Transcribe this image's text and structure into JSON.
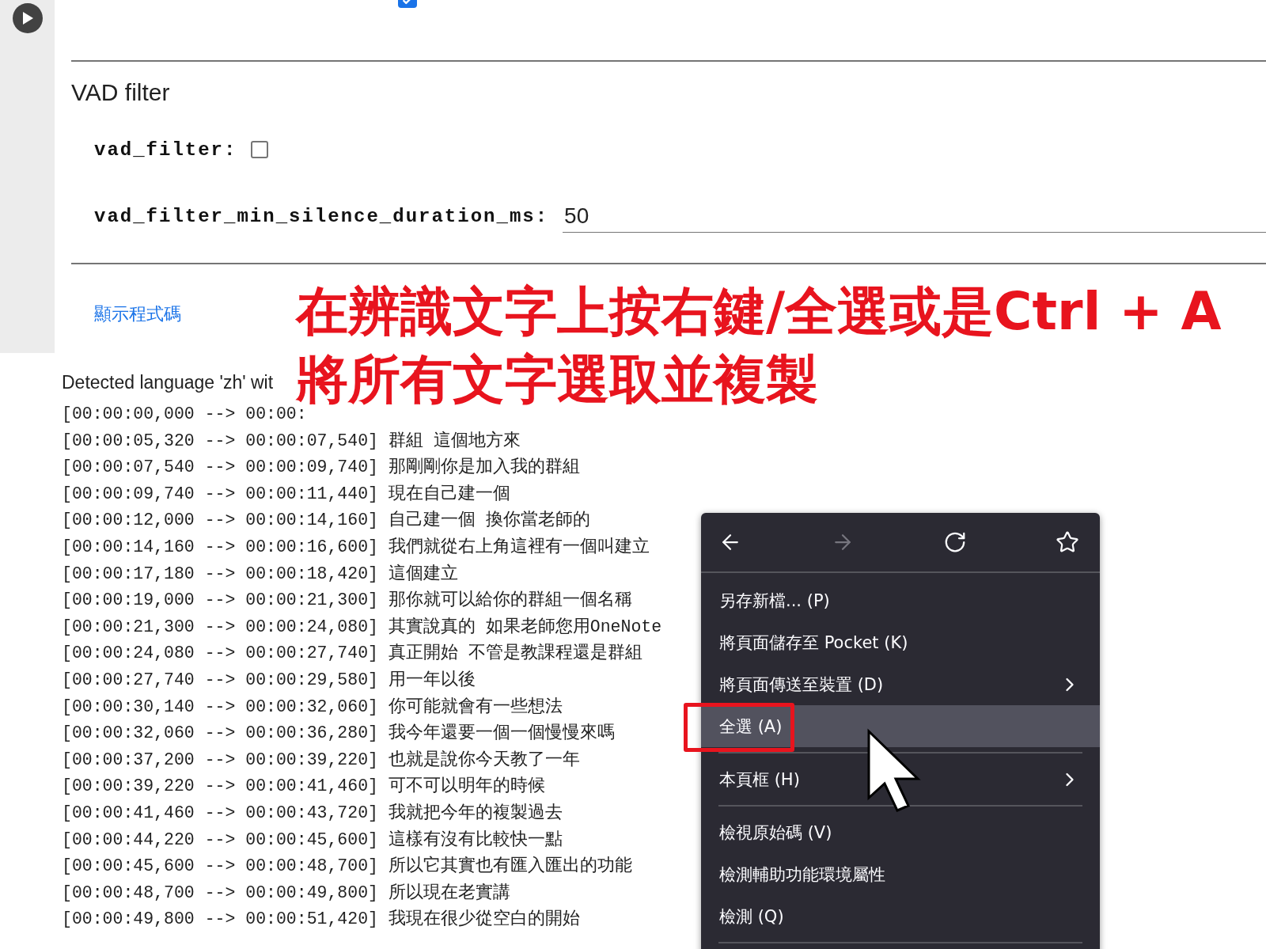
{
  "cell": {
    "top_checkbox": {
      "checked": true
    },
    "section": {
      "title": "VAD filter",
      "params": [
        {
          "kind": "checkbox",
          "label": "vad_filter:",
          "checked": false
        },
        {
          "kind": "text",
          "label": "vad_filter_min_silence_duration_ms:",
          "value": "50"
        }
      ]
    },
    "show_code_link": "顯示程式碼"
  },
  "output": {
    "detected": "Detected language 'zh' wit",
    "lines": [
      "[00:00:00,000 --> 00:00:",
      "[00:00:05,320 --> 00:00:07,540] 群組 這個地方來",
      "[00:00:07,540 --> 00:00:09,740] 那剛剛你是加入我的群組",
      "[00:00:09,740 --> 00:00:11,440] 現在自己建一個",
      "[00:00:12,000 --> 00:00:14,160] 自己建一個 換你當老師的",
      "[00:00:14,160 --> 00:00:16,600] 我們就從右上角這裡有一個叫建立",
      "[00:00:17,180 --> 00:00:18,420] 這個建立",
      "[00:00:19,000 --> 00:00:21,300] 那你就可以給你的群組一個名稱",
      "[00:00:21,300 --> 00:00:24,080] 其實說真的 如果老師您用OneNote",
      "[00:00:24,080 --> 00:00:27,740] 真正開始 不管是教課程還是群組",
      "[00:00:27,740 --> 00:00:29,580] 用一年以後",
      "[00:00:30,140 --> 00:00:32,060] 你可能就會有一些想法",
      "[00:00:32,060 --> 00:00:36,280] 我今年還要一個一個慢慢來嗎",
      "[00:00:37,200 --> 00:00:39,220] 也就是說你今天教了一年",
      "[00:00:39,220 --> 00:00:41,460] 可不可以明年的時候",
      "[00:00:41,460 --> 00:00:43,720] 我就把今年的複製過去",
      "[00:00:44,220 --> 00:00:45,600] 這樣有沒有比較快一點",
      "[00:00:45,600 --> 00:00:48,700] 所以它其實也有匯入匯出的功能",
      "[00:00:48,700 --> 00:00:49,800] 所以現在老實講",
      "[00:00:49,800 --> 00:00:51,420] 我現在很少從空白的開始"
    ]
  },
  "annotation": [
    "在辨識文字上按右鍵/全選或是Ctrl + A",
    "將所有文字選取並複製"
  ],
  "context_menu": {
    "nav": [
      {
        "kind": "back",
        "disabled": false
      },
      {
        "kind": "forward",
        "disabled": true
      },
      {
        "kind": "reload",
        "disabled": false
      },
      {
        "kind": "bookmark",
        "disabled": false
      }
    ],
    "items": [
      {
        "kind": "item",
        "label": "另存新檔... (P)",
        "submenu": false,
        "selected": false
      },
      {
        "kind": "item",
        "label": "將頁面儲存至 Pocket (K)",
        "submenu": false,
        "selected": false
      },
      {
        "kind": "item",
        "label": "將頁面傳送至裝置 (D)",
        "submenu": true,
        "selected": false
      },
      {
        "kind": "item",
        "label": "全選 (A)",
        "submenu": false,
        "selected": true
      },
      {
        "kind": "separator"
      },
      {
        "kind": "item",
        "label": "本頁框 (H)",
        "submenu": true,
        "selected": false
      },
      {
        "kind": "separator"
      },
      {
        "kind": "item",
        "label": "檢視原始碼 (V)",
        "submenu": false,
        "selected": false
      },
      {
        "kind": "item",
        "label": "檢測輔助功能環境屬性",
        "submenu": false,
        "selected": false
      },
      {
        "kind": "item",
        "label": "檢測 (Q)",
        "submenu": false,
        "selected": false
      },
      {
        "kind": "separator"
      }
    ]
  }
}
